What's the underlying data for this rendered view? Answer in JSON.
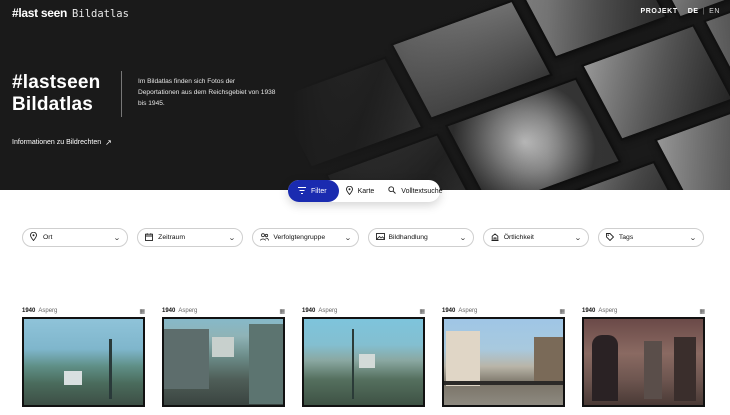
{
  "header": {
    "brand": "#last seen",
    "subtitle": "Bildatlas",
    "nav_project": "PROJEKT",
    "lang_de": "DE",
    "lang_sep": "|",
    "lang_en": "EN"
  },
  "hero": {
    "title_line1": "#lastseen",
    "title_line2": "Bildatlas",
    "description": "Im Bildatlas finden sich Fotos der Deportationen aus dem Reichsgebiet von 1938 bis 1945.",
    "rights_link": "Informationen zu Bildrechten",
    "rights_icon": "arrow-up-right-icon"
  },
  "filterbar": {
    "filter": "Filter",
    "map": "Karte",
    "search": "Volltextsuche"
  },
  "dropdowns": [
    {
      "label": "Ort",
      "icon": "location-pin-icon"
    },
    {
      "label": "Zeitraum",
      "icon": "calendar-icon"
    },
    {
      "label": "Verfolgtengruppe",
      "icon": "people-icon"
    },
    {
      "label": "Bildhandlung",
      "icon": "image-icon"
    },
    {
      "label": "Örtlichkeit",
      "icon": "building-icon"
    },
    {
      "label": "Tags",
      "icon": "tag-icon"
    }
  ],
  "cards": [
    {
      "year": "1940",
      "place": "Asperg"
    },
    {
      "year": "1940",
      "place": "Asperg"
    },
    {
      "year": "1940",
      "place": "Asperg"
    },
    {
      "year": "1940",
      "place": "Asperg"
    },
    {
      "year": "1940",
      "place": "Asperg"
    }
  ],
  "colors": {
    "accent": "#1a2bb0",
    "hero_bg": "#1a1a1a"
  }
}
